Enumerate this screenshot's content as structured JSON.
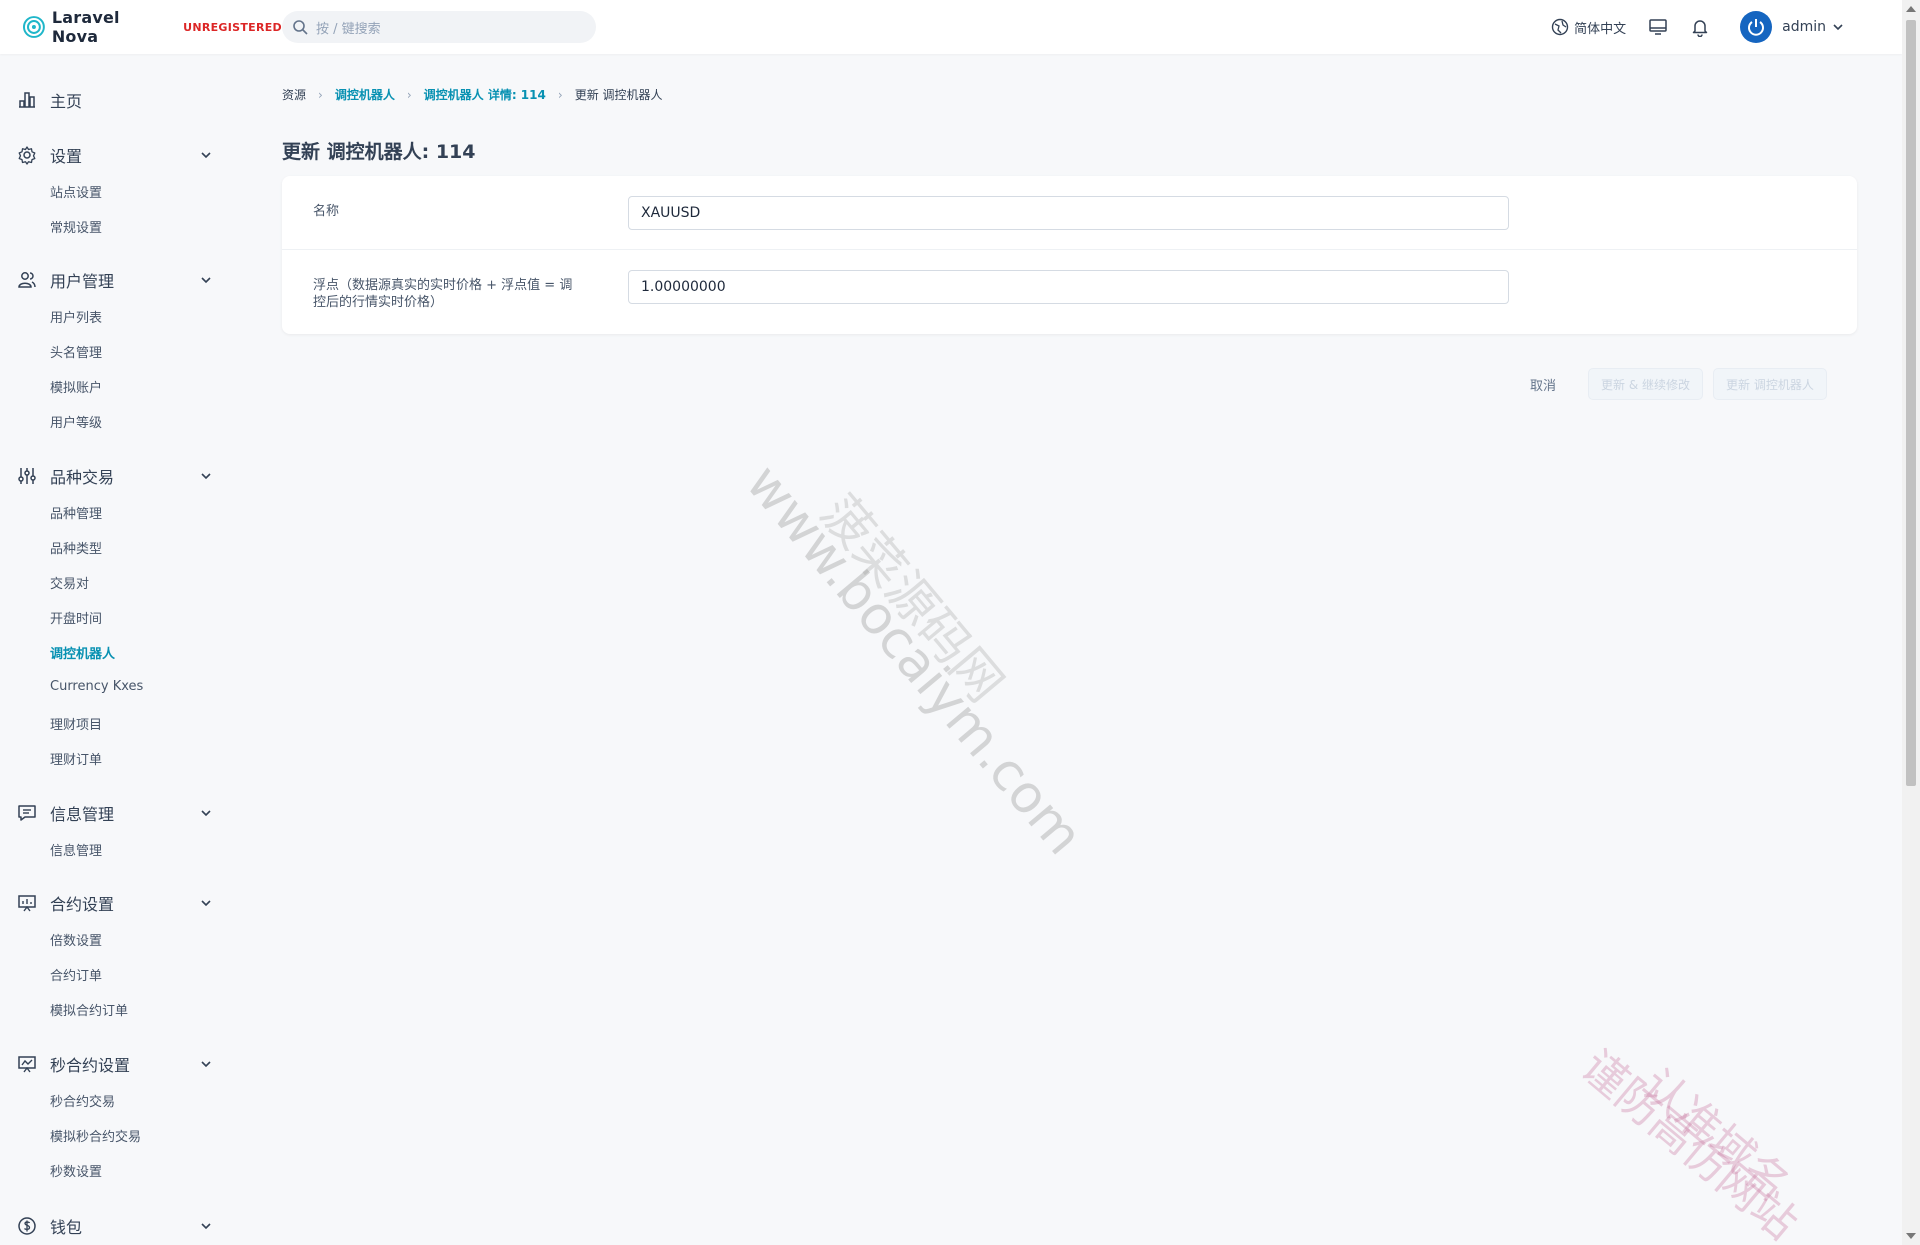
{
  "brand": {
    "name": "Laravel Nova",
    "badge": "UNREGISTERED",
    "accent": "#0891b2"
  },
  "search": {
    "placeholder": "按 / 键搜索"
  },
  "header": {
    "language": "简体中文",
    "user_name": "admin"
  },
  "sidebar": {
    "groups": [
      {
        "label": "主页",
        "icon": "chart-bar-icon",
        "items": []
      },
      {
        "label": "设置",
        "icon": "gear-icon",
        "items": [
          "站点设置",
          "常规设置"
        ]
      },
      {
        "label": "用户管理",
        "icon": "users-icon",
        "items": [
          "用户列表",
          "头名管理",
          "模拟账户",
          "用户等级"
        ]
      },
      {
        "label": "品种交易",
        "icon": "sliders-icon",
        "items": [
          "品种管理",
          "品种类型",
          "交易对",
          "开盘时间",
          "调控机器人",
          "Currency Kxes",
          "理财项目",
          "理财订单"
        ]
      },
      {
        "label": "信息管理",
        "icon": "chat-icon",
        "items": [
          "信息管理"
        ]
      },
      {
        "label": "合约设置",
        "icon": "presentation-icon",
        "items": [
          "倍数设置",
          "合约订单",
          "模拟合约订单"
        ]
      },
      {
        "label": "秒合约设置",
        "icon": "presentation-chart-icon",
        "items": [
          "秒合约交易",
          "模拟秒合约交易",
          "秒数设置"
        ]
      },
      {
        "label": "钱包",
        "icon": "dollar-icon",
        "items": []
      }
    ],
    "active_item": "调控机器人"
  },
  "breadcrumb": [
    "资源",
    "调控机器人",
    "调控机器人 详情: 114",
    "更新 调控机器人"
  ],
  "page": {
    "title": "更新 调控机器人: 114"
  },
  "form": {
    "fields": [
      {
        "label": "名称",
        "value": "XAUUSD"
      },
      {
        "label": "浮点（数据源真实的实时价格 + 浮点值 = 调控后的行情实时价格）",
        "value": "1.00000000"
      }
    ],
    "cancel_label": "取消",
    "update_continue_label": "更新 & 继续修改",
    "update_label": "更新 调控机器人"
  },
  "watermarks": [
    "www.bocaiym.com",
    "菠菜源码网",
    "认准域名",
    "谨防高仿网站"
  ]
}
